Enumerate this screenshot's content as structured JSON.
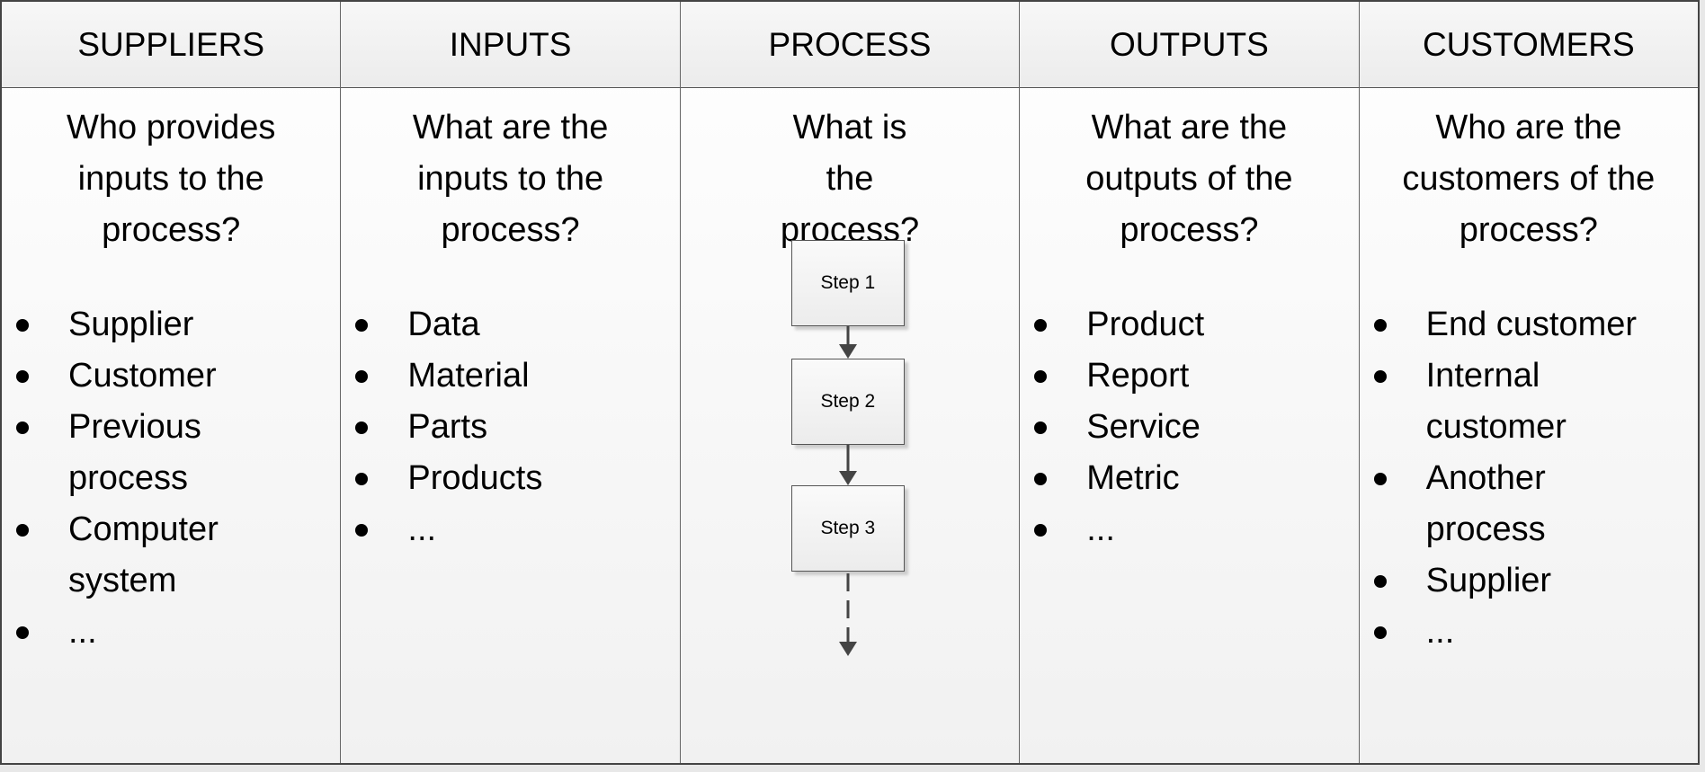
{
  "columns": [
    {
      "header": "SUPPLIERS",
      "question": "Who provides inputs to the process?",
      "items": [
        "Supplier",
        "Customer",
        "Previous process",
        "Computer system",
        "..."
      ]
    },
    {
      "header": "INPUTS",
      "question": "What are the inputs to the process?",
      "items": [
        "Data",
        "Material",
        "Parts",
        "Products",
        "..."
      ]
    },
    {
      "header": "PROCESS",
      "question": "What is the process?",
      "steps": [
        "Step 1",
        "Step 2",
        "Step 3"
      ]
    },
    {
      "header": "OUTPUTS",
      "question": "What are the outputs of the process?",
      "items": [
        "Product",
        "Report",
        "Service",
        "Metric",
        "..."
      ]
    },
    {
      "header": "CUSTOMERS",
      "question": "Who are the customers of the process?",
      "items": [
        "End customer",
        "Internal customer",
        "Another process",
        "Supplier",
        "..."
      ]
    }
  ]
}
